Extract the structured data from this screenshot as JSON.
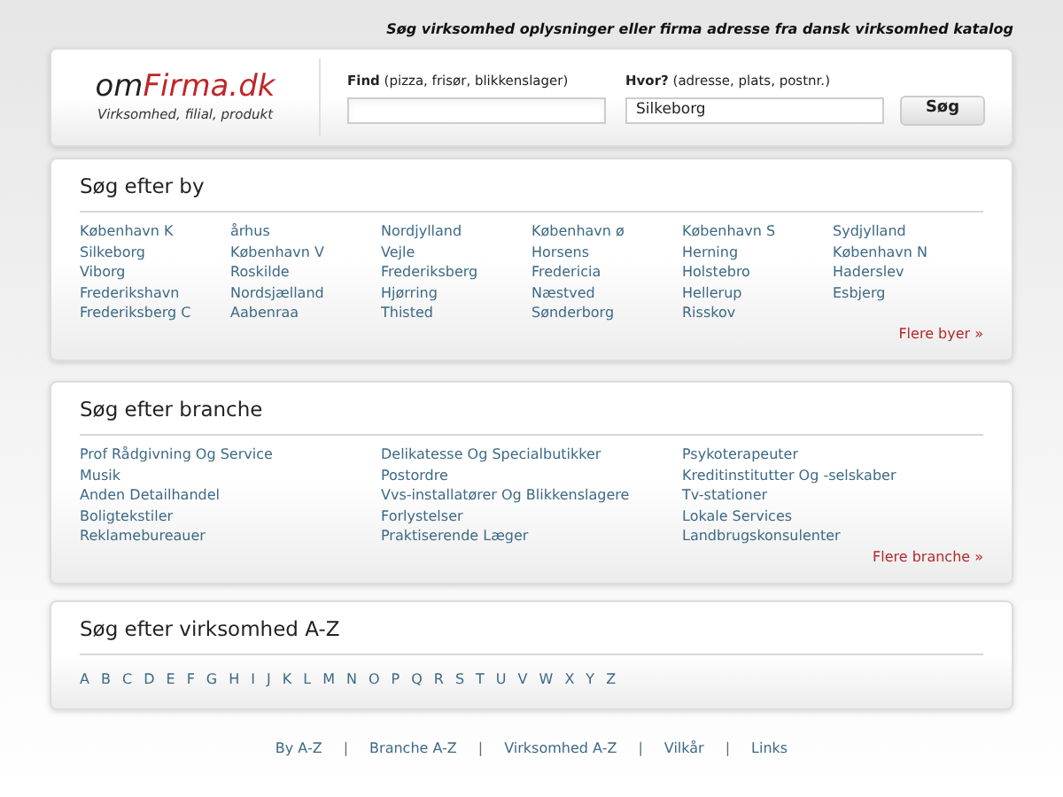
{
  "tagline": "Søg virksomhed oplysninger eller firma adresse fra dansk virksomhed katalog",
  "logo": {
    "prefix": "om",
    "main": "Firma.dk",
    "subtitle": "Virksomhed, filial, produkt"
  },
  "search": {
    "find_label": "Find",
    "find_hint": "(pizza, frisør, blikkenslager)",
    "where_label": "Hvor?",
    "where_hint": "(adresse, plats, postnr.)",
    "where_value": "Silkeborg",
    "button": "Søg"
  },
  "cities": {
    "title": "Søg efter by",
    "columns": [
      [
        "København K",
        "Silkeborg",
        "Viborg",
        "Frederikshavn",
        "Frederiksberg C"
      ],
      [
        "århus",
        "København V",
        "Roskilde",
        "Nordsjælland",
        "Aabenraa"
      ],
      [
        "Nordjylland",
        "Vejle",
        "Frederiksberg",
        "Hjørring",
        "Thisted"
      ],
      [
        "København ø",
        "Horsens",
        "Fredericia",
        "Næstved",
        "Sønderborg"
      ],
      [
        "København S",
        "Herning",
        "Holstebro",
        "Hellerup",
        "Risskov"
      ],
      [
        "Sydjylland",
        "København N",
        "Haderslev",
        "Esbjerg"
      ]
    ],
    "more": "Flere byer »"
  },
  "branches": {
    "title": "Søg efter branche",
    "columns": [
      [
        "Prof Rådgivning Og Service",
        "Musik",
        "Anden Detailhandel",
        "Boligtekstiler",
        "Reklamebureauer"
      ],
      [
        "Delikatesse Og Specialbutikker",
        "Postordre",
        "Vvs-installatører Og Blikkenslagere",
        "Forlystelser",
        "Praktiserende Læger"
      ],
      [
        "Psykoterapeuter",
        "Kreditinstitutter Og -selskaber",
        "Tv-stationer",
        "Lokale Services",
        "Landbrugskonsulenter"
      ]
    ],
    "more": "Flere branche »"
  },
  "az": {
    "title": "Søg efter virksomhed A-Z",
    "letters": [
      "A",
      "B",
      "C",
      "D",
      "E",
      "F",
      "G",
      "H",
      "I",
      "J",
      "K",
      "L",
      "M",
      "N",
      "O",
      "P",
      "Q",
      "R",
      "S",
      "T",
      "U",
      "V",
      "W",
      "X",
      "Y",
      "Z"
    ]
  },
  "footer": [
    {
      "kind": "link",
      "text": "By A-Z"
    },
    {
      "kind": "separator",
      "text": "|"
    },
    {
      "kind": "link",
      "text": "Branche A-Z"
    },
    {
      "kind": "separator",
      "text": "|"
    },
    {
      "kind": "link",
      "text": "Virksomhed A-Z"
    },
    {
      "kind": "separator",
      "text": "|"
    },
    {
      "kind": "link",
      "text": "Vilkår"
    },
    {
      "kind": "separator",
      "text": "|"
    },
    {
      "kind": "link",
      "text": "Links"
    }
  ]
}
